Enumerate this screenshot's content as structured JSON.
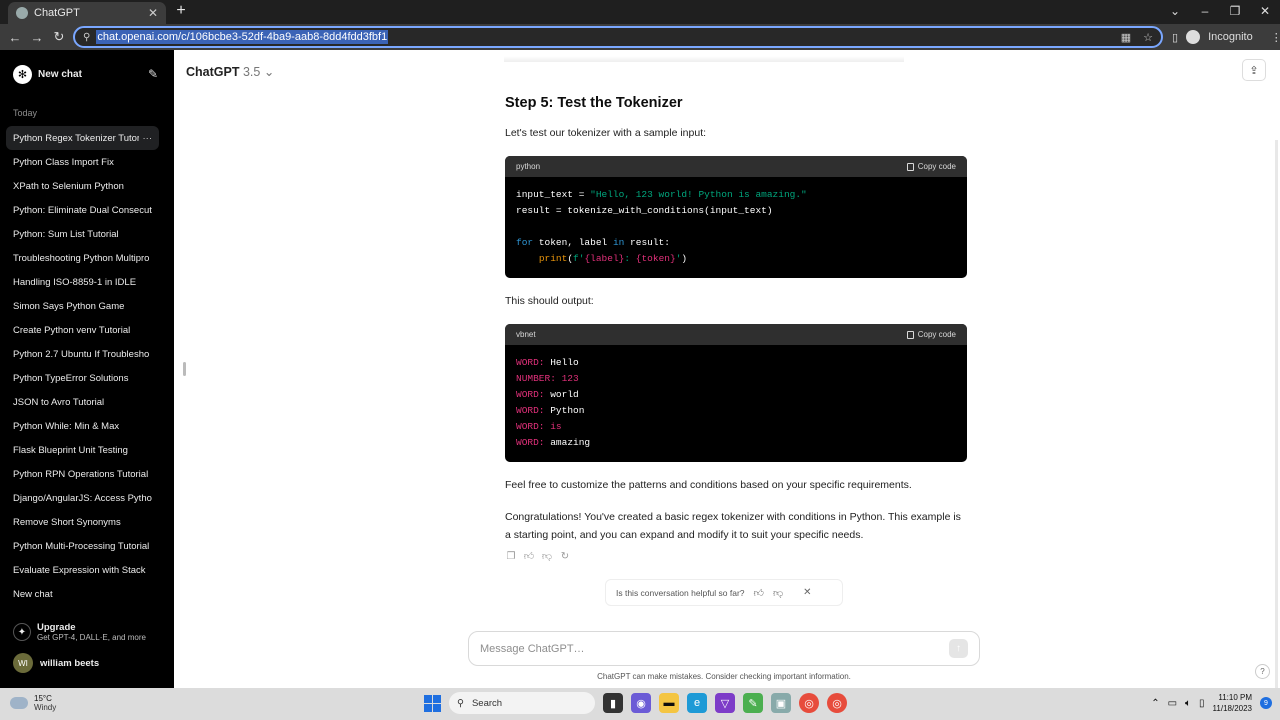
{
  "browser": {
    "tab_title": "ChatGPT",
    "new_tab": "+",
    "url": "chat.openai.com/c/106bcbe3-52df-4ba9-aab8-8dd4fdd3fbf1",
    "incognito_label": "Incognito"
  },
  "sidebar": {
    "new_chat": "New chat",
    "section_today": "Today",
    "conversations": [
      "Python Regex Tokenizer Tutor",
      "Python Class Import Fix",
      "XPath to Selenium Python",
      "Python: Eliminate Dual Consecuti",
      "Python: Sum List Tutorial",
      "Troubleshooting Python Multipro",
      "Handling ISO-8859-1 in IDLE",
      "Simon Says Python Game",
      "Create Python venv Tutorial",
      "Python 2.7 Ubuntu If Troublesho",
      "Python TypeError Solutions",
      "JSON to Avro Tutorial",
      "Python While: Min & Max",
      "Flask Blueprint Unit Testing",
      "Python RPN Operations Tutorial",
      "Django/AngularJS: Access Pytho",
      "Remove Short Synonyms",
      "Python Multi-Processing Tutorial",
      "Evaluate Expression with Stack",
      "New chat"
    ],
    "upgrade_title": "Upgrade",
    "upgrade_sub": "Get GPT-4, DALL·E, and more",
    "user_initials": "WI",
    "user_name": "william beets"
  },
  "header": {
    "model": "ChatGPT",
    "version": "3.5"
  },
  "message": {
    "step_heading": "Step 5: Test the Tokenizer",
    "intro": "Let's test our tokenizer with a sample input:",
    "code1_lang": "python",
    "copy_label": "Copy code",
    "output_intro": "This should output:",
    "code2_lang": "vbnet",
    "outro1": "Feel free to customize the patterns and conditions based on your specific requirements.",
    "outro2": "Congratulations! You've created a basic regex tokenizer with conditions in Python. This example is a starting point, and you can expand and modify it to suit your specific needs."
  },
  "feedback": {
    "question": "Is this conversation helpful so far?"
  },
  "composer": {
    "placeholder": "Message ChatGPT…",
    "disclaimer": "ChatGPT can make mistakes. Consider checking important information."
  },
  "taskbar": {
    "temp": "15°C",
    "weather": "Windy",
    "search": "Search",
    "time": "11:10 PM",
    "date": "11/18/2023",
    "notif_count": "9"
  }
}
